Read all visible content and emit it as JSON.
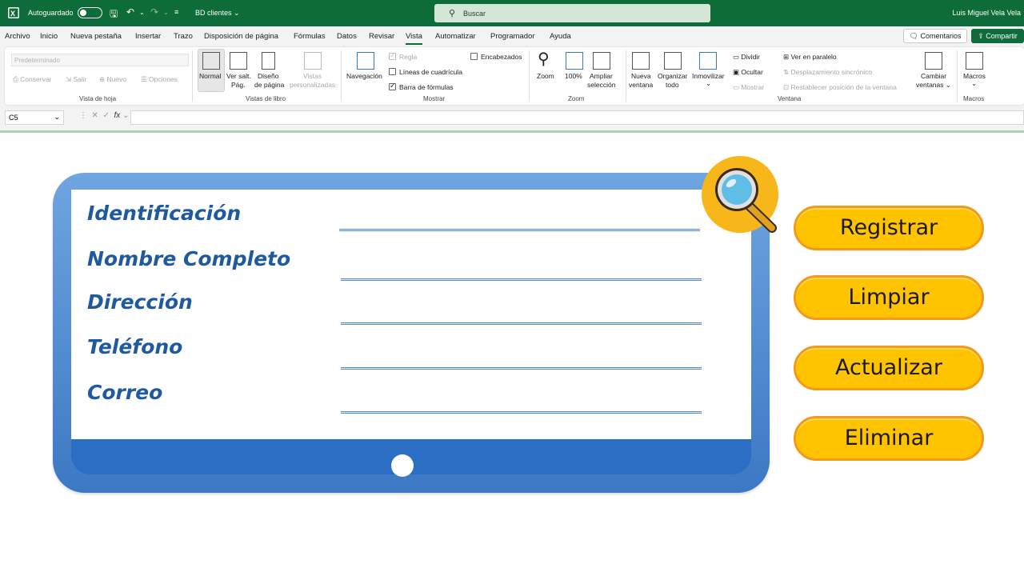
{
  "titlebar": {
    "autosave_label": "Autoguardado",
    "document_name": "BD clientes",
    "search_placeholder": "Buscar",
    "user_name": "Luis Miguel Vela Vela"
  },
  "menu": {
    "tabs": [
      "Archivo",
      "Inicio",
      "Nueva pestaña",
      "Insertar",
      "Trazo",
      "Disposición de página",
      "Fórmulas",
      "Datos",
      "Revisar",
      "Vista",
      "Automatizar",
      "Programador",
      "Ayuda"
    ],
    "active_tab": "Vista",
    "comments_label": "Comentarios",
    "share_label": "Compartir"
  },
  "ribbon": {
    "sheet_view": {
      "select_value": "Predeterminado",
      "keep": "Conservar",
      "exit": "Salir",
      "new": "Nuevo",
      "options": "Opciones",
      "group_label": "Vista de hoja"
    },
    "workbook_views": {
      "normal": "Normal",
      "page_break_1": "Ver salt.",
      "page_break_2": "Pág.",
      "page_layout_1": "Diseño",
      "page_layout_2": "de página",
      "custom_1": "Vistas",
      "custom_2": "personalizadas",
      "group_label": "Vistas de libro"
    },
    "show": {
      "navigation": "Navegación",
      "ruler": "Regla",
      "gridlines": "Líneas de cuadrícula",
      "formula_bar": "Barra de fórmulas",
      "headings": "Encabezados",
      "group_label": "Mostrar"
    },
    "zoom": {
      "zoom": "Zoom",
      "hundred": "100%",
      "zoom_sel_1": "Ampliar",
      "zoom_sel_2": "selección",
      "group_label": "Zoom"
    },
    "window": {
      "new_1": "Nueva",
      "new_2": "ventana",
      "arrange_1": "Organizar",
      "arrange_2": "todo",
      "freeze": "Inmovilizar",
      "split": "Dividir",
      "hide": "Ocultar",
      "unhide": "Mostrar",
      "side_by_side": "Ver en paralelo",
      "sync_scroll": "Desplazamiento sincrónico",
      "reset_pos": "Restablecer posición de la ventana",
      "switch_1": "Cambiar",
      "switch_2": "ventanas",
      "group_label": "Ventana"
    },
    "macros": {
      "macros": "Macros",
      "group_label": "Macros"
    }
  },
  "formula_bar": {
    "name_box": "C5",
    "fx": "fx"
  },
  "form": {
    "labels": [
      "Identificación",
      "Nombre Completo",
      "Dirección",
      "Teléfono",
      "Correo"
    ]
  },
  "actions": {
    "register": "Registrar",
    "clear": "Limpiar",
    "update": "Actualizar",
    "delete": "Eliminar"
  },
  "colors": {
    "excel_green": "#0e6b3a",
    "tablet_blue": "#3c78c4",
    "label_blue": "#1f5aa0",
    "button_yellow": "#ffc300",
    "button_border": "#f39a19"
  }
}
